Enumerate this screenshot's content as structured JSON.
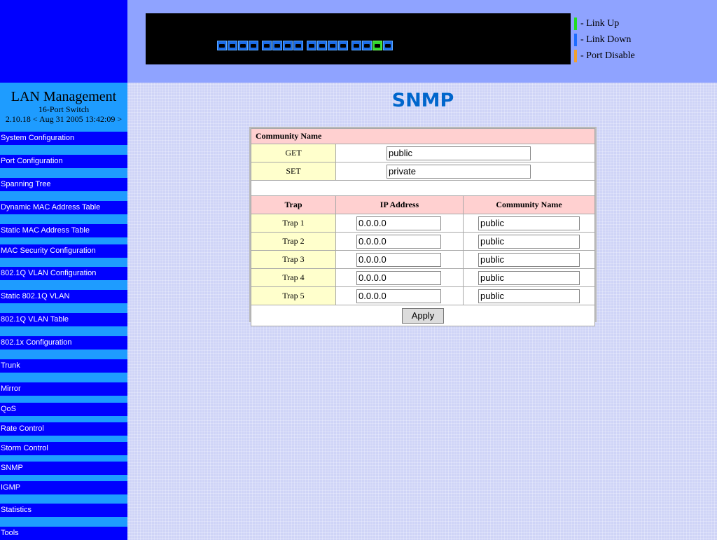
{
  "legend": [
    {
      "label": "- Link Up",
      "color": "#22dd22"
    },
    {
      "label": "- Link Down",
      "color": "#1e6cff"
    },
    {
      "label": "- Port Disable",
      "color": "#f0a030"
    }
  ],
  "ports": {
    "count": 16,
    "up": [
      15
    ],
    "colors": {
      "up": "#33d62b",
      "down": "#1b6ce8"
    }
  },
  "brand": {
    "title": "LAN Management",
    "subtitle": "16-Port Switch",
    "version": "2.10.18 < Aug 31 2005 13:42:09 >"
  },
  "nav": [
    "System Configuration",
    "Port Configuration",
    "Spanning Tree",
    "Dynamic MAC Address Table",
    "Static MAC Address Table",
    "MAC Security Configuration",
    "802.1Q VLAN Configuration",
    "Static 802.1Q VLAN",
    "802.1Q VLAN Table",
    "802.1x Configuration",
    "Trunk",
    "Mirror",
    "QoS",
    "Rate Control",
    "Storm Control",
    "SNMP",
    "IGMP",
    "Statistics",
    "Tools"
  ],
  "page": {
    "title": "SNMP"
  },
  "community": {
    "header": "Community Name",
    "get_label": "GET",
    "get_value": "public",
    "set_label": "SET",
    "set_value": "private"
  },
  "traps": {
    "headers": {
      "trap": "Trap",
      "ip": "IP Address",
      "community": "Community Name"
    },
    "rows": [
      {
        "label": "Trap 1",
        "ip": "0.0.0.0",
        "community": "public"
      },
      {
        "label": "Trap 2",
        "ip": "0.0.0.0",
        "community": "public"
      },
      {
        "label": "Trap 3",
        "ip": "0.0.0.0",
        "community": "public"
      },
      {
        "label": "Trap 4",
        "ip": "0.0.0.0",
        "community": "public"
      },
      {
        "label": "Trap 5",
        "ip": "0.0.0.0",
        "community": "public"
      }
    ]
  },
  "apply_label": "Apply"
}
